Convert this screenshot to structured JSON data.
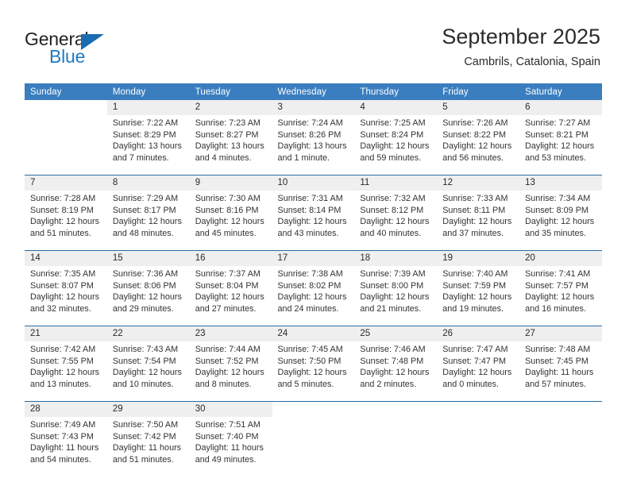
{
  "logo": {
    "word1": "General",
    "word2": "Blue",
    "triangle_color": "#1a6cb0",
    "blue_text_color": "#1f7bc1"
  },
  "header": {
    "title": "September 2025",
    "location": "Cambrils, Catalonia, Spain"
  },
  "theme": {
    "header_row_bg": "#3a7ebf",
    "daynum_bg": "#efefef",
    "week_separator": "#2b6ca3",
    "body_text": "#333333"
  },
  "weekday_headers": [
    "Sunday",
    "Monday",
    "Tuesday",
    "Wednesday",
    "Thursday",
    "Friday",
    "Saturday"
  ],
  "weeks": [
    {
      "days": [
        {
          "date": "",
          "lines": []
        },
        {
          "date": "1",
          "lines": [
            "Sunrise: 7:22 AM",
            "Sunset: 8:29 PM",
            "Daylight: 13 hours",
            "and 7 minutes."
          ]
        },
        {
          "date": "2",
          "lines": [
            "Sunrise: 7:23 AM",
            "Sunset: 8:27 PM",
            "Daylight: 13 hours",
            "and 4 minutes."
          ]
        },
        {
          "date": "3",
          "lines": [
            "Sunrise: 7:24 AM",
            "Sunset: 8:26 PM",
            "Daylight: 13 hours",
            "and 1 minute."
          ]
        },
        {
          "date": "4",
          "lines": [
            "Sunrise: 7:25 AM",
            "Sunset: 8:24 PM",
            "Daylight: 12 hours",
            "and 59 minutes."
          ]
        },
        {
          "date": "5",
          "lines": [
            "Sunrise: 7:26 AM",
            "Sunset: 8:22 PM",
            "Daylight: 12 hours",
            "and 56 minutes."
          ]
        },
        {
          "date": "6",
          "lines": [
            "Sunrise: 7:27 AM",
            "Sunset: 8:21 PM",
            "Daylight: 12 hours",
            "and 53 minutes."
          ]
        }
      ]
    },
    {
      "days": [
        {
          "date": "7",
          "lines": [
            "Sunrise: 7:28 AM",
            "Sunset: 8:19 PM",
            "Daylight: 12 hours",
            "and 51 minutes."
          ]
        },
        {
          "date": "8",
          "lines": [
            "Sunrise: 7:29 AM",
            "Sunset: 8:17 PM",
            "Daylight: 12 hours",
            "and 48 minutes."
          ]
        },
        {
          "date": "9",
          "lines": [
            "Sunrise: 7:30 AM",
            "Sunset: 8:16 PM",
            "Daylight: 12 hours",
            "and 45 minutes."
          ]
        },
        {
          "date": "10",
          "lines": [
            "Sunrise: 7:31 AM",
            "Sunset: 8:14 PM",
            "Daylight: 12 hours",
            "and 43 minutes."
          ]
        },
        {
          "date": "11",
          "lines": [
            "Sunrise: 7:32 AM",
            "Sunset: 8:12 PM",
            "Daylight: 12 hours",
            "and 40 minutes."
          ]
        },
        {
          "date": "12",
          "lines": [
            "Sunrise: 7:33 AM",
            "Sunset: 8:11 PM",
            "Daylight: 12 hours",
            "and 37 minutes."
          ]
        },
        {
          "date": "13",
          "lines": [
            "Sunrise: 7:34 AM",
            "Sunset: 8:09 PM",
            "Daylight: 12 hours",
            "and 35 minutes."
          ]
        }
      ]
    },
    {
      "days": [
        {
          "date": "14",
          "lines": [
            "Sunrise: 7:35 AM",
            "Sunset: 8:07 PM",
            "Daylight: 12 hours",
            "and 32 minutes."
          ]
        },
        {
          "date": "15",
          "lines": [
            "Sunrise: 7:36 AM",
            "Sunset: 8:06 PM",
            "Daylight: 12 hours",
            "and 29 minutes."
          ]
        },
        {
          "date": "16",
          "lines": [
            "Sunrise: 7:37 AM",
            "Sunset: 8:04 PM",
            "Daylight: 12 hours",
            "and 27 minutes."
          ]
        },
        {
          "date": "17",
          "lines": [
            "Sunrise: 7:38 AM",
            "Sunset: 8:02 PM",
            "Daylight: 12 hours",
            "and 24 minutes."
          ]
        },
        {
          "date": "18",
          "lines": [
            "Sunrise: 7:39 AM",
            "Sunset: 8:00 PM",
            "Daylight: 12 hours",
            "and 21 minutes."
          ]
        },
        {
          "date": "19",
          "lines": [
            "Sunrise: 7:40 AM",
            "Sunset: 7:59 PM",
            "Daylight: 12 hours",
            "and 19 minutes."
          ]
        },
        {
          "date": "20",
          "lines": [
            "Sunrise: 7:41 AM",
            "Sunset: 7:57 PM",
            "Daylight: 12 hours",
            "and 16 minutes."
          ]
        }
      ]
    },
    {
      "days": [
        {
          "date": "21",
          "lines": [
            "Sunrise: 7:42 AM",
            "Sunset: 7:55 PM",
            "Daylight: 12 hours",
            "and 13 minutes."
          ]
        },
        {
          "date": "22",
          "lines": [
            "Sunrise: 7:43 AM",
            "Sunset: 7:54 PM",
            "Daylight: 12 hours",
            "and 10 minutes."
          ]
        },
        {
          "date": "23",
          "lines": [
            "Sunrise: 7:44 AM",
            "Sunset: 7:52 PM",
            "Daylight: 12 hours",
            "and 8 minutes."
          ]
        },
        {
          "date": "24",
          "lines": [
            "Sunrise: 7:45 AM",
            "Sunset: 7:50 PM",
            "Daylight: 12 hours",
            "and 5 minutes."
          ]
        },
        {
          "date": "25",
          "lines": [
            "Sunrise: 7:46 AM",
            "Sunset: 7:48 PM",
            "Daylight: 12 hours",
            "and 2 minutes."
          ]
        },
        {
          "date": "26",
          "lines": [
            "Sunrise: 7:47 AM",
            "Sunset: 7:47 PM",
            "Daylight: 12 hours",
            "and 0 minutes."
          ]
        },
        {
          "date": "27",
          "lines": [
            "Sunrise: 7:48 AM",
            "Sunset: 7:45 PM",
            "Daylight: 11 hours",
            "and 57 minutes."
          ]
        }
      ]
    },
    {
      "days": [
        {
          "date": "28",
          "lines": [
            "Sunrise: 7:49 AM",
            "Sunset: 7:43 PM",
            "Daylight: 11 hours",
            "and 54 minutes."
          ]
        },
        {
          "date": "29",
          "lines": [
            "Sunrise: 7:50 AM",
            "Sunset: 7:42 PM",
            "Daylight: 11 hours",
            "and 51 minutes."
          ]
        },
        {
          "date": "30",
          "lines": [
            "Sunrise: 7:51 AM",
            "Sunset: 7:40 PM",
            "Daylight: 11 hours",
            "and 49 minutes."
          ]
        },
        {
          "date": "",
          "lines": []
        },
        {
          "date": "",
          "lines": []
        },
        {
          "date": "",
          "lines": []
        },
        {
          "date": "",
          "lines": []
        }
      ]
    }
  ]
}
